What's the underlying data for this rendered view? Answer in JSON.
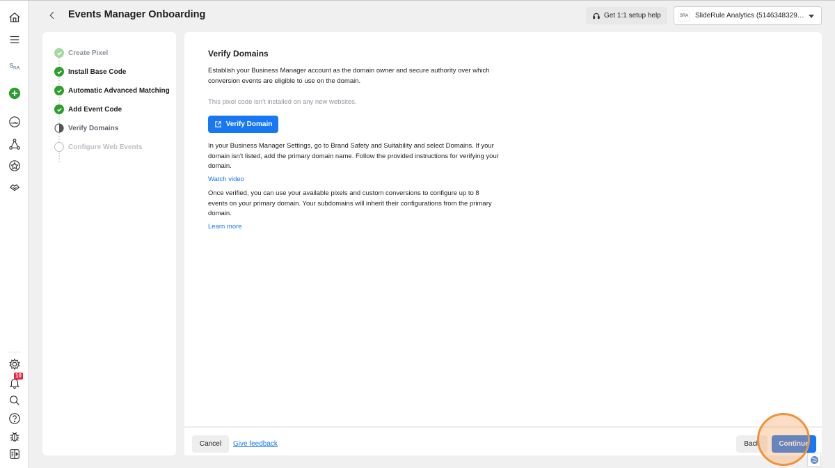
{
  "header": {
    "title": "Events Manager Onboarding",
    "help_button": "Get 1:1 setup help",
    "account_selector": "SlideRule Analytics (5146348329…",
    "account_logo": "SRA"
  },
  "rail": {
    "notifications_count": "10",
    "account_initials": "SRA"
  },
  "steps": [
    {
      "label": "Create Pixel",
      "status": "complete-faded"
    },
    {
      "label": "Install Base Code",
      "status": "complete"
    },
    {
      "label": "Automatic Advanced Matching",
      "status": "complete"
    },
    {
      "label": "Add Event Code",
      "status": "complete"
    },
    {
      "label": "Verify Domains",
      "status": "current"
    },
    {
      "label": "Configure Web Events",
      "status": "pending"
    }
  ],
  "main": {
    "title": "Verify Domains",
    "intro": "Establish your Business Manager account as the domain owner and secure authority over which conversion events are eligible to use on the domain.",
    "notice": "This pixel code isn't installed on any new websites.",
    "verify_button": "Verify Domain",
    "instructions": "In your Business Manager Settings, go to Brand Safety and Suitability and select Domains. If your domain isn't listed, add the primary domain name. Follow the provided instructions for verifying your domain.",
    "watch_video": "Watch video",
    "after_verify": "Once verified, you can use your available pixels and custom conversions to configure up to 8 events on your primary domain. Your subdomains will inherit their configurations from the primary domain.",
    "learn_more": "Learn more"
  },
  "footer": {
    "cancel": "Cancel",
    "feedback": "Give feedback",
    "back": "Back",
    "continue": "Continue"
  },
  "colors": {
    "accent": "#1877f2",
    "success": "#42b72a",
    "click_indicator": "#f0923a"
  }
}
